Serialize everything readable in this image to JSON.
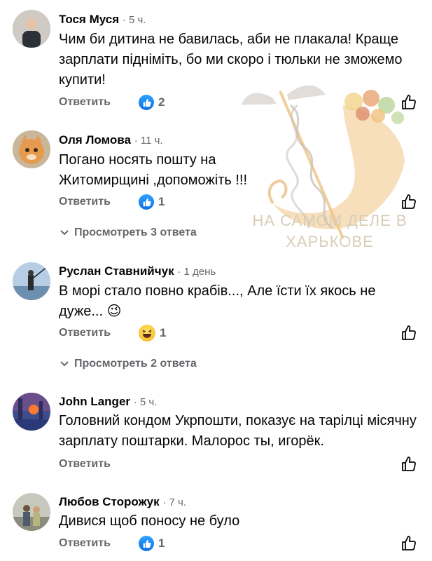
{
  "comments": [
    {
      "name": "Тося Муся",
      "time": "5 ч.",
      "text": "Чим би дитина не бавилась, аби не плакала! Краще зарплати підніміть, бо ми скоро і тюльки не зможемо купити!",
      "reply_label": "Ответить",
      "reaction_icon": "like",
      "reaction_count": "2"
    },
    {
      "name": "Оля Ломова",
      "time": "11 ч.",
      "text": "Погано носять пошту на Житомирщині ,допоможіть !!!",
      "reply_label": "Ответить",
      "reaction_icon": "like",
      "reaction_count": "1",
      "view_replies": "Просмотреть 3 ответа"
    },
    {
      "name": "Руслан Ставнийчук",
      "time": "1 день",
      "text": "В морі стало повно крабів..., Але   їсти їх якось не дуже... 😉",
      "reply_label": "Ответить",
      "reaction_icon": "haha",
      "reaction_count": "1",
      "view_replies": "Просмотреть 2 ответа"
    },
    {
      "name": "John Langer",
      "time": "5 ч.",
      "text": "Головний кондом Укрпошти, показує на тарілці місячну зарплату поштарки. Малорос ты, игорёк.",
      "reply_label": "Ответить"
    },
    {
      "name": "Любов Сторожук",
      "time": "7 ч.",
      "text": "Дивися щоб поносу не було",
      "reply_label": "Ответить",
      "reaction_icon": "like",
      "reaction_count": "1"
    }
  ],
  "watermark": {
    "line1": "НА САМОМ ДЕЛЕ В",
    "line2": "ХАРЬКОВЕ"
  },
  "separator": "·",
  "colors": {
    "meta_gray": "#65676b",
    "like_blue": "#0a6ee8",
    "text": "#050505"
  }
}
